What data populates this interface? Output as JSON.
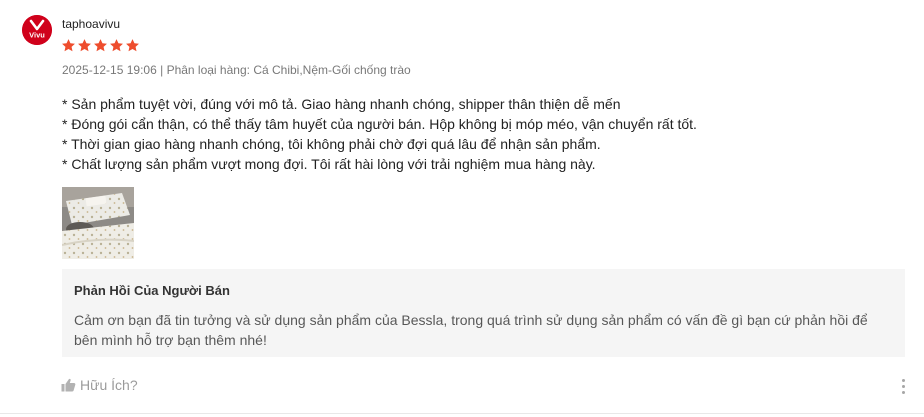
{
  "review": {
    "username": "taphoavivu",
    "avatar_text": "Vivu",
    "rating": 5,
    "rating_color": "#ee4d2d",
    "datetime": "2025-12-15 19:06",
    "separator": "|",
    "variation_label": "Phân loại hàng:",
    "variation_value": "Cá Chibi,Nệm-Gối chống trào",
    "lines": [
      "* Sản phẩm tuyệt vời, đúng với mô tả. Giao hàng nhanh chóng, shipper thân thiện dễ mến",
      "* Đóng gói cẩn thận, có thể thấy tâm huyết của người bán. Hộp không bị móp méo, vận chuyển rất tốt.",
      "* Thời gian giao hàng nhanh chóng, tôi không phải chờ đợi quá lâu để nhận sản phẩm.",
      "* Chất lượng sản phẩm vượt mong đợi. Tôi rất hài lòng với trải nghiệm mua hàng này."
    ],
    "media_count": 1
  },
  "seller_reply": {
    "title": "Phản Hồi Của Người Bán",
    "text": "Cảm ơn bạn đã tin tưởng và sử dụng sản phẩm của Bessla, trong quá trình sử dụng sản phẩm có vấn đề gì bạn cứ phản hồi để bên mình hỗ trợ bạn thêm nhé!"
  },
  "actions": {
    "helpful_label": "Hữu Ích?",
    "helpful_icon": "thumbs-up-icon",
    "more_icon": "more-vertical-icon"
  },
  "colors": {
    "brand_red": "#d0011b",
    "star": "#ee4d2d",
    "reply_bg": "#f5f5f5"
  }
}
